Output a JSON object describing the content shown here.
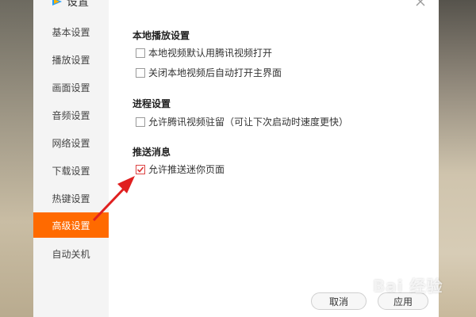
{
  "window": {
    "title": "设置"
  },
  "sidebar": {
    "items": [
      {
        "label": "基本设置"
      },
      {
        "label": "播放设置"
      },
      {
        "label": "画面设置"
      },
      {
        "label": "音频设置"
      },
      {
        "label": "网络设置"
      },
      {
        "label": "下载设置"
      },
      {
        "label": "热键设置"
      },
      {
        "label": "高级设置",
        "active": true
      },
      {
        "label": "自动关机"
      }
    ]
  },
  "sections": [
    {
      "title": "本地播放设置",
      "options": [
        {
          "label": "本地视频默认用腾讯视频打开",
          "checked": false
        },
        {
          "label": "关闭本地视频后自动打开主界面",
          "checked": false
        }
      ]
    },
    {
      "title": "进程设置",
      "options": [
        {
          "label": "允许腾讯视频驻留（可让下次启动时速度更快）",
          "checked": false
        }
      ]
    },
    {
      "title": "推送消息",
      "options": [
        {
          "label": "允许推送迷你页面",
          "checked": true
        }
      ]
    }
  ],
  "footer": {
    "cancel_label": "取消",
    "apply_label": "应用"
  },
  "colors": {
    "accent": "#ff6a00",
    "arrow": "#e02020"
  },
  "watermark": {
    "text": "Bai 经验"
  }
}
